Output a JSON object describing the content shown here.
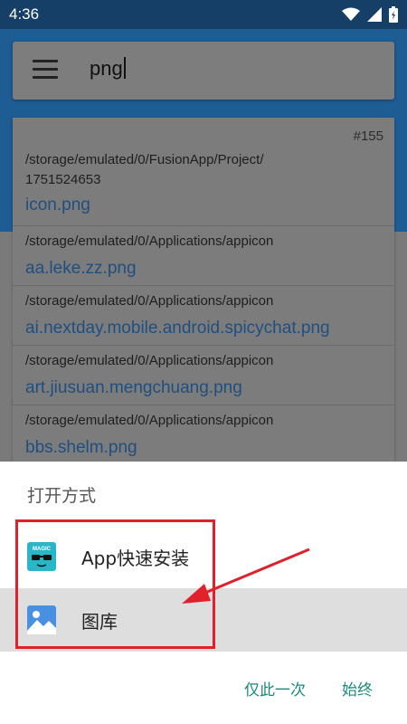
{
  "status_bar": {
    "time": "4:36"
  },
  "search": {
    "query": "png"
  },
  "results": {
    "count": "#155",
    "items": [
      {
        "path_line1": "/storage/emulated/0/FusionApp/Project/",
        "path_line2": "1751524653",
        "file": "icon.png"
      },
      {
        "path_line1": "/storage/emulated/0/Applications/appicon",
        "file": "aa.leke.zz.png"
      },
      {
        "path_line1": "/storage/emulated/0/Applications/appicon",
        "file": "ai.nextday.mobile.android.spicychat.png"
      },
      {
        "path_line1": "/storage/emulated/0/Applications/appicon",
        "file": "art.jiusuan.mengchuang.png"
      },
      {
        "path_line1": "/storage/emulated/0/Applications/appicon",
        "file": "bbs.shelm.png"
      }
    ]
  },
  "open_with": {
    "title": "打开方式",
    "options": [
      {
        "label": "App快速安装",
        "icon": "magic-app-icon",
        "icon_text": "MAGIC"
      },
      {
        "label": "图库",
        "icon": "gallery-icon"
      }
    ],
    "just_once": "仅此一次",
    "always": "始终"
  },
  "colors": {
    "accent": "#1a8a7a",
    "highlight": "#e0202b",
    "app_bar": "#1e5c94"
  }
}
